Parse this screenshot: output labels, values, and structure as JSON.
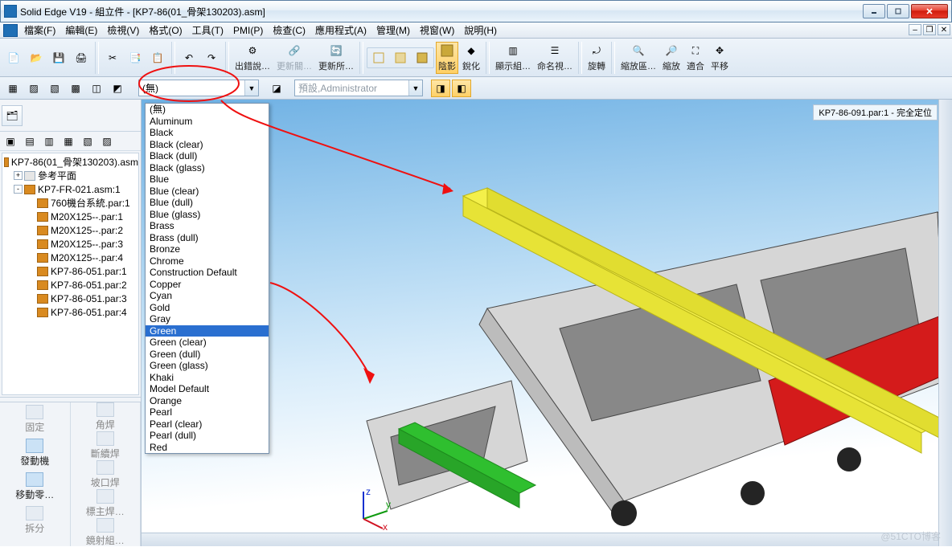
{
  "window": {
    "title": "Solid Edge V19 - 組立件 - [KP7-86(01_骨架130203).asm]",
    "minimize_tip": "Minimize",
    "maximize_tip": "Restore Down",
    "close_tip": "Close"
  },
  "menu": {
    "items": [
      "檔案(F)",
      "編輯(E)",
      "檢視(V)",
      "格式(O)",
      "工具(T)",
      "PMI(P)",
      "檢查(C)",
      "應用程式(A)",
      "管理(M)",
      "視窗(W)",
      "說明(H)"
    ]
  },
  "toolbar_main": {
    "new": "",
    "open": "",
    "save": "",
    "print": "",
    "cut": "",
    "copy": "",
    "paste": "",
    "undo": "",
    "redo": "",
    "cmd_chucuo": "出錯說…",
    "cmd_gengxin1": "更新關…",
    "cmd_gengxin2": "更新所…",
    "cmd_yinying": "陰影",
    "cmd_ruihua": "銳化",
    "cmd_xianshi": "顯示組…",
    "cmd_mingming": "命名視…",
    "cmd_xuanzhuan": "旋轉",
    "cmd_suofangqu": "縮放區…",
    "cmd_suofang": "縮放",
    "cmd_shihe": "適合",
    "cmd_pingyi": "平移"
  },
  "toolbar_style": {
    "combo_value": "(無)",
    "combo2_value": "預設,Administrator"
  },
  "material_list": [
    "(無)",
    "Aluminum",
    "Black",
    "Black (clear)",
    "Black (dull)",
    "Black (glass)",
    "Blue",
    "Blue (clear)",
    "Blue (dull)",
    "Blue (glass)",
    "Brass",
    "Brass (dull)",
    "Bronze",
    "Chrome",
    "Construction Default",
    "Copper",
    "Cyan",
    "Gold",
    "Gray",
    "Green",
    "Green (clear)",
    "Green (dull)",
    "Green (glass)",
    "Khaki",
    "Model Default",
    "Orange",
    "Pearl",
    "Pearl (clear)",
    "Pearl (dull)",
    "Red"
  ],
  "material_selected_index": 19,
  "tree": {
    "root": "KP7-86(01_骨架130203).asm",
    "nodes": [
      {
        "label": "參考平面",
        "icon": "plane",
        "lvl": 1,
        "exp": "+"
      },
      {
        "label": "KP7-FR-021.asm:1",
        "icon": "asm",
        "lvl": 1,
        "exp": "-"
      },
      {
        "label": "760機台系統.par:1",
        "icon": "par",
        "lvl": 2
      },
      {
        "label": "M20X125--.par:1",
        "icon": "par",
        "lvl": 2
      },
      {
        "label": "M20X125--.par:2",
        "icon": "par",
        "lvl": 2
      },
      {
        "label": "M20X125--.par:3",
        "icon": "par",
        "lvl": 2
      },
      {
        "label": "M20X125--.par:4",
        "icon": "par",
        "lvl": 2
      },
      {
        "label": "KP7-86-051.par:1",
        "icon": "par",
        "lvl": 2
      },
      {
        "label": "KP7-86-051.par:2",
        "icon": "par",
        "lvl": 2
      },
      {
        "label": "KP7-86-051.par:3",
        "icon": "par",
        "lvl": 2
      },
      {
        "label": "KP7-86-051.par:4",
        "icon": "par",
        "lvl": 2
      }
    ]
  },
  "left_commands": {
    "col1": [
      {
        "label": "固定",
        "on": false
      },
      {
        "label": "發動機",
        "on": true
      },
      {
        "label": "移動零…",
        "on": true
      },
      {
        "label": "拆分",
        "on": false
      }
    ],
    "col2": [
      {
        "label": "角焊",
        "on": false
      },
      {
        "label": "斷續焊",
        "on": false
      },
      {
        "label": "坡口焊",
        "on": false
      },
      {
        "label": "標主焊…",
        "on": false
      },
      {
        "label": "鏡射組…",
        "on": false
      }
    ]
  },
  "viewport": {
    "part_label": "KP7-86-091.par:1 - 完全定位",
    "axes": {
      "x": "x",
      "y": "y",
      "z": "z"
    }
  },
  "watermark": "@51CTO博客"
}
